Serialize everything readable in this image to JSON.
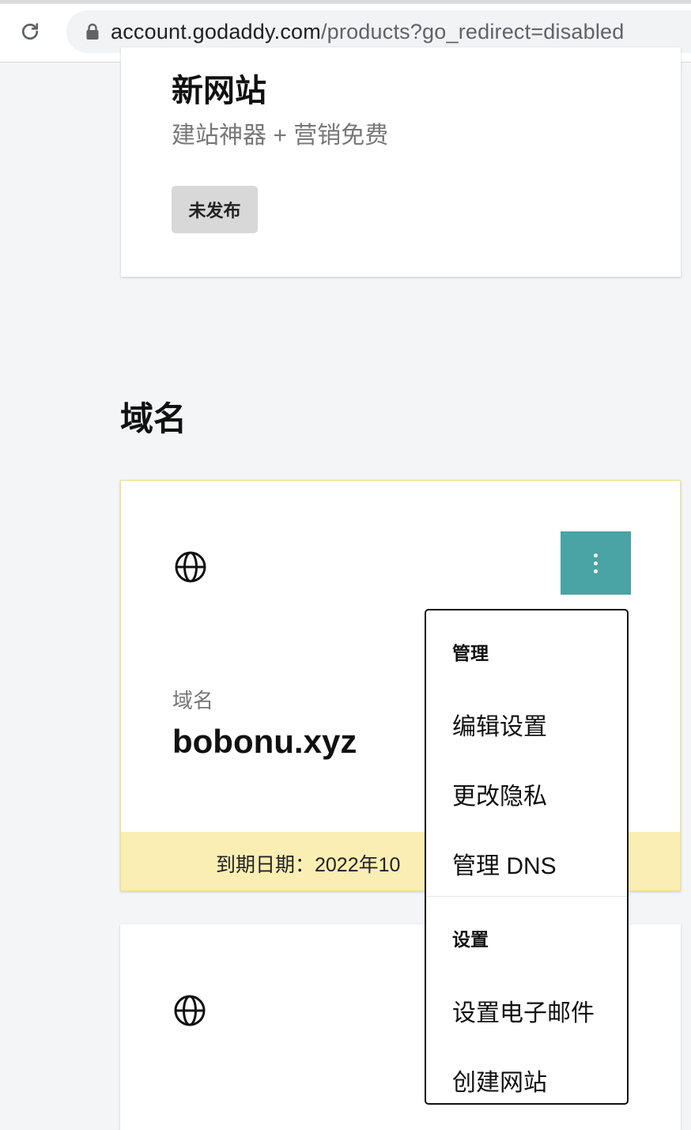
{
  "browser": {
    "url_host": "account.godaddy.com",
    "url_path": "/products?go_redirect=disabled"
  },
  "website_card": {
    "title": "新网站",
    "subtitle": "建站神器 + 营销免费",
    "status": "未发布"
  },
  "domains_section": {
    "heading": "域名"
  },
  "domain_card": {
    "label": "域名",
    "name": "bobonu.xyz",
    "expiry": "到期日期：2022年10"
  },
  "dropdown_menu": {
    "manage_heading": "管理",
    "edit_settings": "编辑设置",
    "change_privacy": "更改隐私",
    "manage_dns": "管理 DNS",
    "setup_heading": "设置",
    "setup_email": "设置电子邮件",
    "create_website": "创建网站"
  },
  "colors": {
    "accent_teal": "#4aa3a4",
    "expiry_bar": "#fbeeb3",
    "page_bg": "#f4f5f7"
  },
  "icons": [
    "reload-icon",
    "lock-icon",
    "globe-icon",
    "more-vertical-icon"
  ]
}
